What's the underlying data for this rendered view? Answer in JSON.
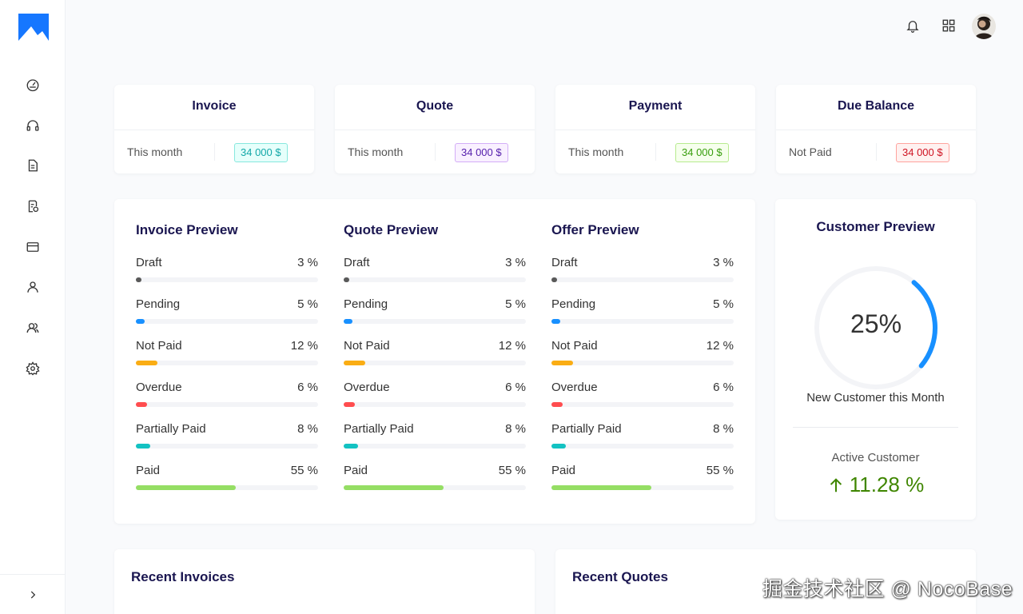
{
  "brand": {
    "logo_icon": "mountain-logo",
    "color": "#1677ff"
  },
  "sidebar": {
    "items": [
      {
        "icon": "dashboard-icon"
      },
      {
        "icon": "headset-icon"
      },
      {
        "icon": "file-text-icon"
      },
      {
        "icon": "file-check-icon"
      },
      {
        "icon": "credit-card-icon"
      },
      {
        "icon": "user-icon"
      },
      {
        "icon": "team-icon"
      },
      {
        "icon": "settings-icon"
      }
    ],
    "collapse_icon": "chevron-right-icon"
  },
  "topbar": {
    "icons": [
      "bell-icon",
      "apps-grid-icon"
    ],
    "avatar": "user-avatar"
  },
  "stats": [
    {
      "title": "Invoice",
      "label": "This month",
      "value": "34 000 $",
      "color": "#13a8a8",
      "bg": "#e6fffb",
      "border": "#87e8de"
    },
    {
      "title": "Quote",
      "label": "This month",
      "value": "34 000 $",
      "color": "#531dab",
      "bg": "#f9f0ff",
      "border": "#d3adf7"
    },
    {
      "title": "Payment",
      "label": "This month",
      "value": "34 000 $",
      "color": "#389e0d",
      "bg": "#f6ffed",
      "border": "#b7eb8f"
    },
    {
      "title": "Due Balance",
      "label": "Not Paid",
      "value": "34 000 $",
      "color": "#cf1322",
      "bg": "#fff1f0",
      "border": "#ffa39e"
    }
  ],
  "previews": [
    {
      "title": "Invoice Preview",
      "rows": [
        {
          "label": "Draft",
          "percent": "3 %",
          "value": 3,
          "color": "#595959"
        },
        {
          "label": "Pending",
          "percent": "5 %",
          "value": 5,
          "color": "#1890ff"
        },
        {
          "label": "Not Paid",
          "percent": "12 %",
          "value": 12,
          "color": "#faad14"
        },
        {
          "label": "Overdue",
          "percent": "6 %",
          "value": 6,
          "color": "#ff4d4f"
        },
        {
          "label": "Partially Paid",
          "percent": "8 %",
          "value": 8,
          "color": "#13c2c2"
        },
        {
          "label": "Paid",
          "percent": "55 %",
          "value": 55,
          "color": "#95de64"
        }
      ]
    },
    {
      "title": "Quote Preview",
      "rows": [
        {
          "label": "Draft",
          "percent": "3 %",
          "value": 3,
          "color": "#595959"
        },
        {
          "label": "Pending",
          "percent": "5 %",
          "value": 5,
          "color": "#1890ff"
        },
        {
          "label": "Not Paid",
          "percent": "12 %",
          "value": 12,
          "color": "#faad14"
        },
        {
          "label": "Overdue",
          "percent": "6 %",
          "value": 6,
          "color": "#ff4d4f"
        },
        {
          "label": "Partially Paid",
          "percent": "8 %",
          "value": 8,
          "color": "#13c2c2"
        },
        {
          "label": "Paid",
          "percent": "55 %",
          "value": 55,
          "color": "#95de64"
        }
      ]
    },
    {
      "title": "Offer Preview",
      "rows": [
        {
          "label": "Draft",
          "percent": "3 %",
          "value": 3,
          "color": "#595959"
        },
        {
          "label": "Pending",
          "percent": "5 %",
          "value": 5,
          "color": "#1890ff"
        },
        {
          "label": "Not Paid",
          "percent": "12 %",
          "value": 12,
          "color": "#faad14"
        },
        {
          "label": "Overdue",
          "percent": "6 %",
          "value": 6,
          "color": "#ff4d4f"
        },
        {
          "label": "Partially Paid",
          "percent": "8 %",
          "value": 8,
          "color": "#13c2c2"
        },
        {
          "label": "Paid",
          "percent": "55 %",
          "value": 55,
          "color": "#95de64"
        }
      ]
    }
  ],
  "customer": {
    "title": "Customer Preview",
    "percent_text": "25%",
    "percent": 25,
    "gauge_color": "#1890ff",
    "subtitle": "New Customer this Month",
    "active_label": "Active Customer",
    "growth": "11.28 %",
    "growth_icon": "arrow-up-icon",
    "growth_color": "#3f8600"
  },
  "recent": {
    "invoices_title": "Recent Invoices",
    "quotes_title": "Recent Quotes"
  },
  "watermark": "掘金技术社区 @ NocoBase"
}
